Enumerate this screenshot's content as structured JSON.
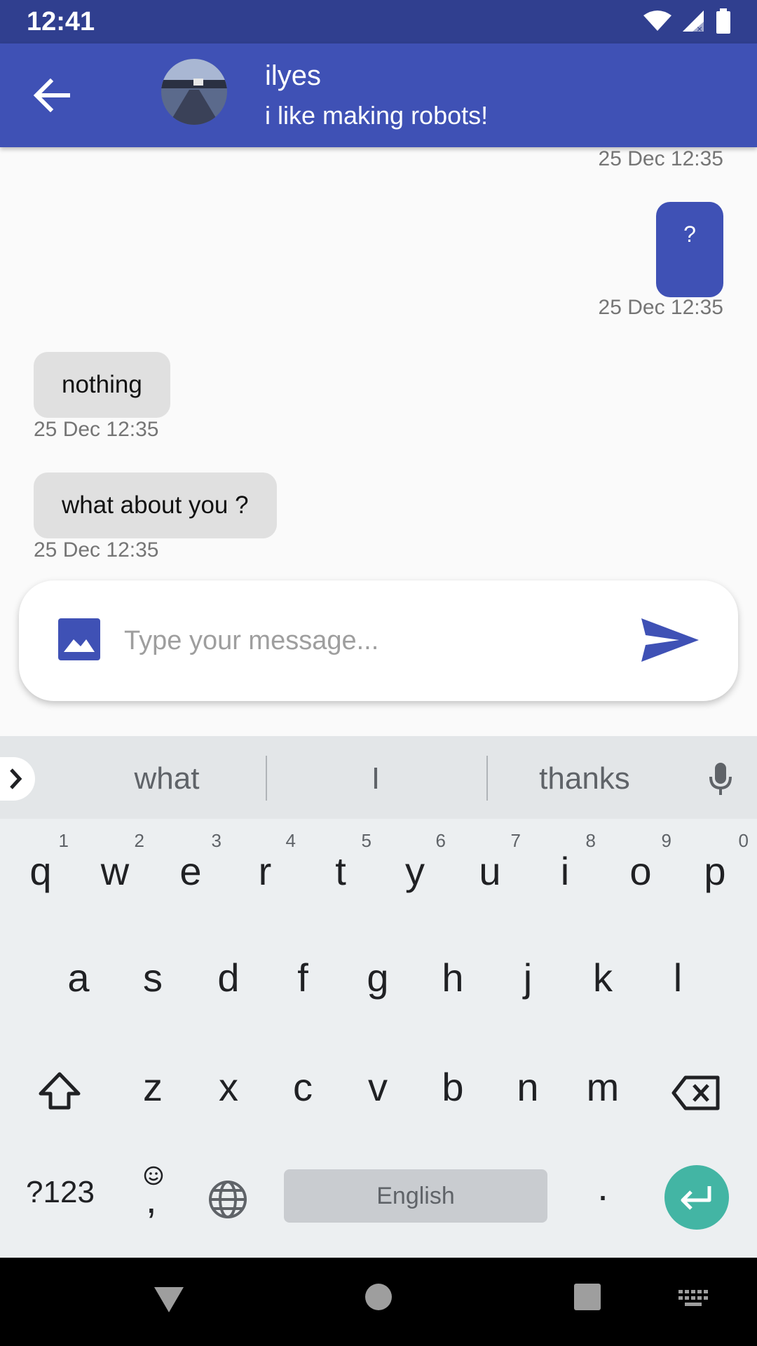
{
  "status_bar": {
    "time": "12:41"
  },
  "app_bar": {
    "name": "ilyes",
    "status": "i like making robots!"
  },
  "messages": [
    {
      "side": "right",
      "timestamp": "25 Dec 12:35"
    },
    {
      "side": "right",
      "text": "?",
      "timestamp": "25 Dec 12:35"
    },
    {
      "side": "left",
      "text": "nothing",
      "timestamp": "25 Dec 12:35"
    },
    {
      "side": "left",
      "text": "what about you ?",
      "timestamp": "25 Dec 12:35"
    }
  ],
  "composer": {
    "placeholder": "Type your message...",
    "value": ""
  },
  "keyboard": {
    "suggestions": [
      "what",
      "I",
      "thanks"
    ],
    "row1": [
      "q",
      "w",
      "e",
      "r",
      "t",
      "y",
      "u",
      "i",
      "o",
      "p"
    ],
    "row1_hints": [
      "1",
      "2",
      "3",
      "4",
      "5",
      "6",
      "7",
      "8",
      "9",
      "0"
    ],
    "row2": [
      "a",
      "s",
      "d",
      "f",
      "g",
      "h",
      "j",
      "k",
      "l"
    ],
    "row3": [
      "z",
      "x",
      "c",
      "v",
      "b",
      "n",
      "m"
    ],
    "symbols_label": "?123",
    "comma": ",",
    "space_label": "English",
    "period": "."
  },
  "colors": {
    "primary": "#3f51b5",
    "primary_dark": "#303f8f",
    "enter": "#43b5a4"
  }
}
